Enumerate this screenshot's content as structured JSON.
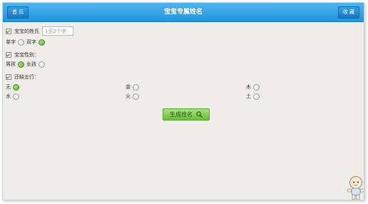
{
  "header": {
    "back_label": "首 页",
    "title": "宝宝专属姓名",
    "right_label": "收 藏"
  },
  "surname": {
    "label": "宝宝的姓氏",
    "placeholder": "1至2个字"
  },
  "name_length": {
    "options": [
      {
        "label": "单字",
        "selected": false
      },
      {
        "label": "双字",
        "selected": true
      }
    ]
  },
  "gender": {
    "label": "宝宝性别：",
    "options": [
      {
        "label": "男孩",
        "selected": true
      },
      {
        "label": "女孩",
        "selected": false
      }
    ]
  },
  "wuxing": {
    "label": "还缺五行：",
    "options": [
      {
        "label": "无",
        "selected": true
      },
      {
        "label": "金",
        "selected": false
      },
      {
        "label": "木",
        "selected": false
      },
      {
        "label": "水",
        "selected": false
      },
      {
        "label": "火",
        "selected": false
      },
      {
        "label": "土",
        "selected": false
      }
    ]
  },
  "generate_button": {
    "label": "生成姓名"
  },
  "colors": {
    "accent": "#2196db",
    "button_green": "#6cbc3e"
  }
}
